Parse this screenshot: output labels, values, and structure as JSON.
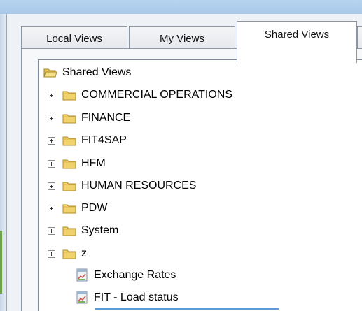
{
  "tabs": [
    {
      "label": "Local Views"
    },
    {
      "label": "My Views"
    },
    {
      "label": "Shared Views",
      "active": true
    }
  ],
  "tree": {
    "root": {
      "label": "Shared Views",
      "icon": "folder-open-icon"
    },
    "folders": [
      {
        "label": "COMMERCIAL OPERATIONS"
      },
      {
        "label": "FINANCE"
      },
      {
        "label": "FIT4SAP"
      },
      {
        "label": "HFM"
      },
      {
        "label": "HUMAN RESOURCES"
      },
      {
        "label": "PDW"
      },
      {
        "label": "System"
      },
      {
        "label": "z"
      }
    ],
    "views": [
      {
        "label": "Exchange Rates",
        "icon": "report-view-icon"
      },
      {
        "label": "FIT - Load status",
        "icon": "report-view-icon"
      }
    ]
  },
  "colors": {
    "titlebar": "#b7d3ee",
    "folder": "#f1d36b",
    "selection": "#5b9bd5"
  }
}
